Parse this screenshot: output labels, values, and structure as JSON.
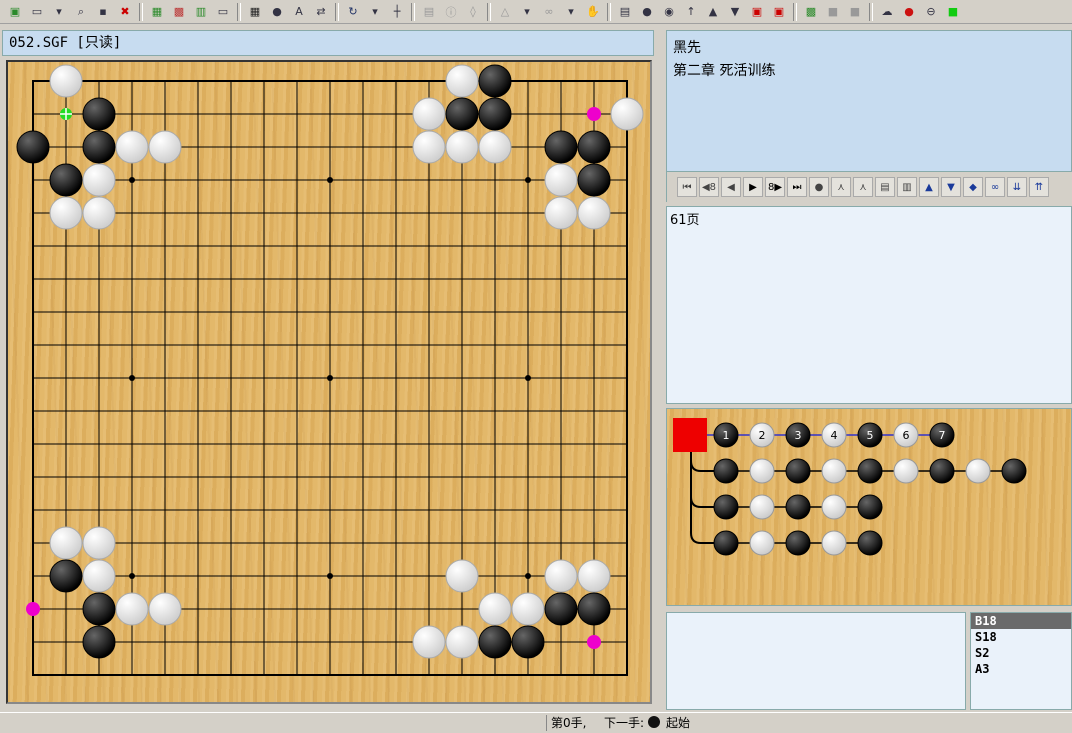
{
  "toolbar": {
    "icons": [
      "new-icon",
      "open-icon",
      "dropdown-arrow-icon",
      "search-icon",
      "save-icon",
      "close-file-icon",
      "board-icon",
      "board-alt-icon",
      "chart-icon",
      "window-icon",
      "grid-icon",
      "number-icon",
      "ab-icon",
      "swap-icon",
      "rotate-icon",
      "dropdown-arrow-icon",
      "coordinate-icon",
      "print-icon",
      "info-icon",
      "erase-icon",
      "triangle-icon",
      "dropdown-arrow-icon",
      "link-icon",
      "dropdown-arrow-icon",
      "hand-icon",
      "list-icon",
      "stone-icon",
      "mark-icon",
      "pointer-icon",
      "first-icon",
      "last-icon",
      "red-icon",
      "red2-icon",
      "green-board-icon",
      "gray-square-icon",
      "gray-square-icon",
      "cloud-icon",
      "pin-icon",
      "stop-icon",
      "green-square-icon"
    ]
  },
  "document": {
    "title": "052.SGF [只读]"
  },
  "info": {
    "line1": "黑先",
    "line2": "第二章  死活训练"
  },
  "nav": {
    "buttons": [
      {
        "name": "first-move-button",
        "label": "⏮"
      },
      {
        "name": "back-8-button",
        "label": "◀8"
      },
      {
        "name": "prev-button",
        "label": "◀"
      },
      {
        "name": "next-button",
        "label": "▶"
      },
      {
        "name": "forward-8-button",
        "label": "8▶"
      },
      {
        "name": "last-move-button",
        "label": "⏭"
      },
      {
        "name": "goto-button",
        "label": "●"
      },
      {
        "name": "var-up-button",
        "label": "⋏"
      },
      {
        "name": "var-down-button",
        "label": "⋏"
      },
      {
        "name": "page-button",
        "label": "▤"
      },
      {
        "name": "page2-button",
        "label": "▥"
      },
      {
        "name": "mark-up-button",
        "label": "▲"
      },
      {
        "name": "mark-down-button",
        "label": "▼"
      },
      {
        "name": "mark-left-button",
        "label": "◆"
      },
      {
        "name": "binoculars-button",
        "label": "∞"
      },
      {
        "name": "branch-down-button",
        "label": "⇊"
      },
      {
        "name": "branch-up-button",
        "label": "⇈"
      }
    ]
  },
  "comment": {
    "text": "61页"
  },
  "board": {
    "size": 19,
    "black": [
      [
        2,
        1
      ],
      [
        0,
        2
      ],
      [
        2,
        2
      ],
      [
        1,
        3
      ],
      [
        14,
        0
      ],
      [
        14,
        1
      ],
      [
        13,
        1
      ],
      [
        16,
        2
      ],
      [
        17,
        2
      ],
      [
        17,
        3
      ],
      [
        1,
        15
      ],
      [
        2,
        16
      ],
      [
        2,
        17
      ],
      [
        17,
        16
      ],
      [
        16,
        16
      ],
      [
        14,
        17
      ],
      [
        15,
        17
      ]
    ],
    "white": [
      [
        1,
        0
      ],
      [
        3,
        2
      ],
      [
        4,
        2
      ],
      [
        2,
        3
      ],
      [
        1,
        4
      ],
      [
        2,
        4
      ],
      [
        2,
        14
      ],
      [
        1,
        14
      ],
      [
        2,
        15
      ],
      [
        3,
        16
      ],
      [
        4,
        16
      ],
      [
        13,
        0
      ],
      [
        12,
        1
      ],
      [
        18,
        1
      ],
      [
        12,
        2
      ],
      [
        13,
        2
      ],
      [
        14,
        2
      ],
      [
        16,
        3
      ],
      [
        16,
        4
      ],
      [
        17,
        4
      ],
      [
        13,
        15
      ],
      [
        16,
        15
      ],
      [
        17,
        15
      ],
      [
        14,
        16
      ],
      [
        15,
        16
      ],
      [
        12,
        17
      ],
      [
        13,
        17
      ]
    ],
    "star_points": [
      [
        3,
        3
      ],
      [
        9,
        3
      ],
      [
        15,
        3
      ],
      [
        3,
        9
      ],
      [
        9,
        9
      ],
      [
        15,
        9
      ],
      [
        3,
        15
      ],
      [
        9,
        15
      ],
      [
        15,
        15
      ]
    ],
    "magenta_marks": [
      [
        17,
        1
      ],
      [
        0,
        16
      ],
      [
        17,
        17
      ]
    ],
    "green_mark": [
      1,
      1
    ]
  },
  "tree": {
    "main": [
      {
        "color": "black",
        "label": "1"
      },
      {
        "color": "white",
        "label": "2"
      },
      {
        "color": "black",
        "label": "3"
      },
      {
        "color": "white",
        "label": "4"
      },
      {
        "color": "black",
        "label": "5"
      },
      {
        "color": "white",
        "label": "6"
      },
      {
        "color": "black",
        "label": "7"
      }
    ],
    "var1": [
      "black",
      "white",
      "black",
      "white",
      "black",
      "white",
      "black",
      "white",
      "black"
    ],
    "var2": [
      "black",
      "white",
      "black",
      "white",
      "black"
    ],
    "var3": [
      "black",
      "white",
      "black",
      "white",
      "black"
    ]
  },
  "moves": {
    "items": [
      "B18",
      "S18",
      "S2",
      "A3"
    ]
  },
  "status": {
    "move_number": "第0手,",
    "next_label": "下一手:",
    "next_state": "起始"
  }
}
